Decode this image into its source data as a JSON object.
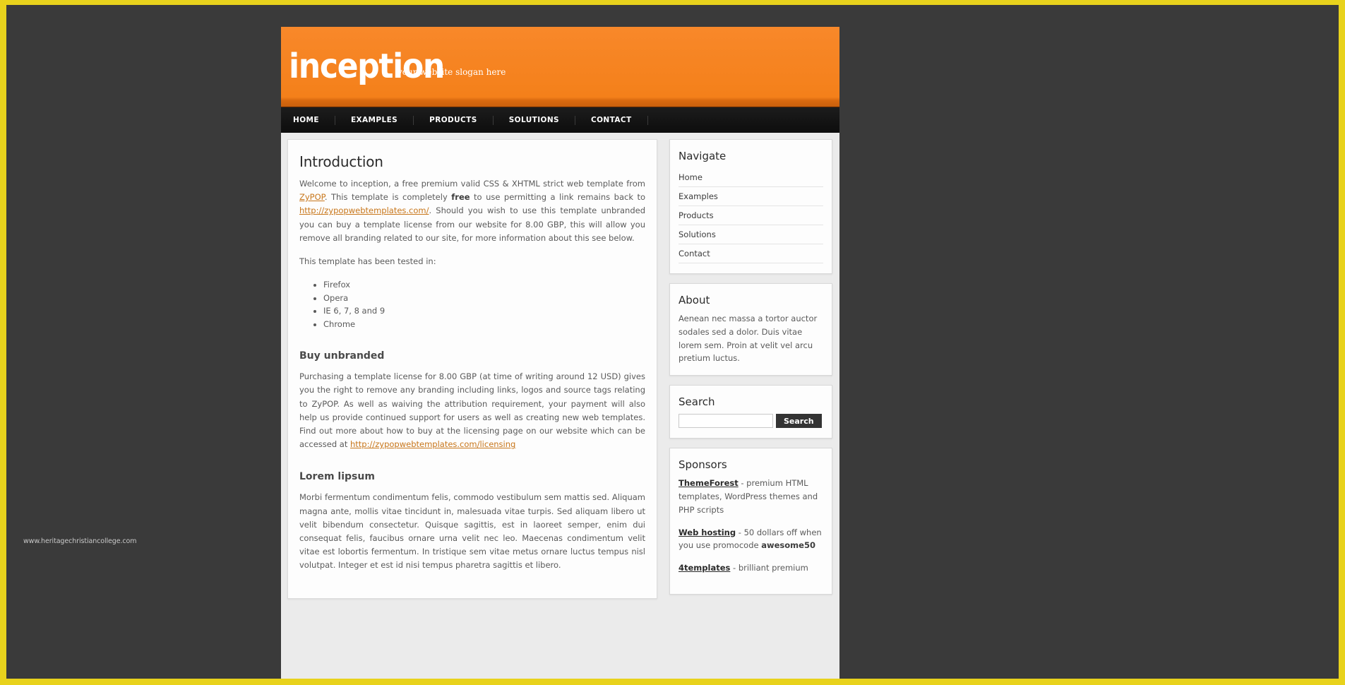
{
  "theme": {
    "frame_color": "#e8d21c",
    "desktop_color": "#3a3a3a",
    "accent_orange": "#f4821f",
    "nav_bg": "#111111",
    "link_color": "#c8761a"
  },
  "header": {
    "logo": "inception",
    "slogan": "your website slogan here"
  },
  "nav": {
    "items": [
      {
        "label": "HOME"
      },
      {
        "label": "EXAMPLES"
      },
      {
        "label": "PRODUCTS"
      },
      {
        "label": "SOLUTIONS"
      },
      {
        "label": "CONTACT"
      }
    ]
  },
  "content": {
    "title": "Introduction",
    "intro": {
      "part1": "Welcome to inception, a free premium valid CSS & XHTML strict web template from ",
      "link1": "ZyPOP",
      "part2": ". This template is completely ",
      "bold1": "free",
      "part3": " to use permitting a link remains back to ",
      "link2": "http://zypopwebtemplates.com/",
      "part4": ". Should you wish to use this template unbranded you can buy a template license from our website for 8.00 GBP, this will allow you remove all branding related to our site, for more information about this see below."
    },
    "tested_intro": "This template has been tested in:",
    "browsers": [
      "Firefox",
      "Opera",
      "IE 6, 7, 8 and 9",
      "Chrome"
    ],
    "buy": {
      "heading": "Buy unbranded",
      "text": "Purchasing a template license for 8.00 GBP (at time of writing around 12 USD) gives you the right to remove any branding including links, logos and source tags relating to ZyPOP. As well as waiving the attribution requirement, your payment will also help us provide continued support for users as well as creating new web templates. Find out more about how to buy at the licensing page on our website which can be accessed at ",
      "link": "http://zypopwebtemplates.com/licensing"
    },
    "lorem": {
      "heading": "Lorem lipsum",
      "text": "Morbi fermentum condimentum felis, commodo vestibulum sem mattis sed. Aliquam magna ante, mollis vitae tincidunt in, malesuada vitae turpis. Sed aliquam libero ut velit bibendum consectetur. Quisque sagittis, est in laoreet semper, enim dui consequat felis, faucibus ornare urna velit nec leo. Maecenas condimentum velit vitae est lobortis fermentum. In tristique sem vitae metus ornare luctus tempus nisl volutpat. Integer et est id nisi tempus pharetra sagittis et libero."
    }
  },
  "sidebar": {
    "navigate": {
      "title": "Navigate",
      "items": [
        {
          "label": "Home"
        },
        {
          "label": "Examples"
        },
        {
          "label": "Products"
        },
        {
          "label": "Solutions"
        },
        {
          "label": "Contact"
        }
      ]
    },
    "about": {
      "title": "About",
      "text": "Aenean nec massa a tortor auctor sodales sed a dolor. Duis vitae lorem sem. Proin at velit vel arcu pretium luctus."
    },
    "search": {
      "title": "Search",
      "value": "",
      "placeholder": "",
      "button_label": "Search"
    },
    "sponsors": {
      "title": "Sponsors",
      "items": [
        {
          "link": "ThemeForest",
          "text": " - premium HTML templates, WordPress themes and PHP scripts",
          "bold": ""
        },
        {
          "link": "Web hosting",
          "text": " - 50 dollars off when you use promocode ",
          "bold": "awesome50"
        },
        {
          "link": "4templates",
          "text": " - brilliant premium",
          "bold": ""
        }
      ]
    }
  },
  "watermark": "www.heritagechristiancollege.com"
}
